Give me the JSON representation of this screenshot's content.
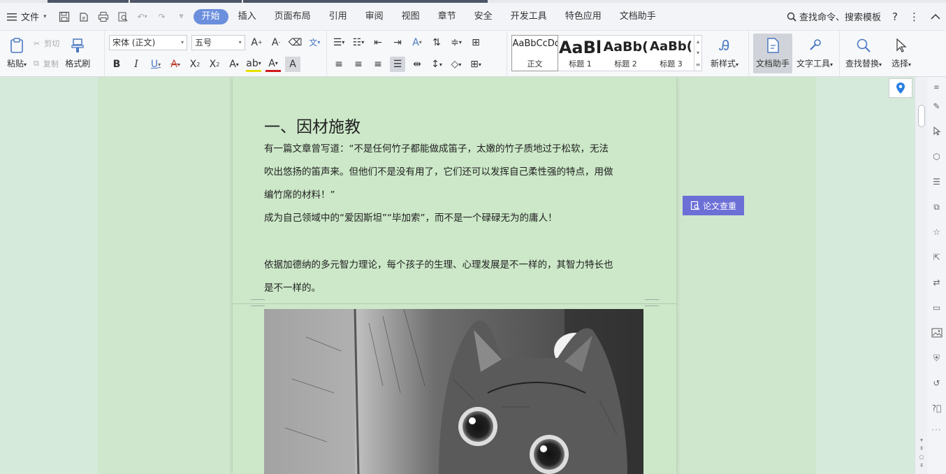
{
  "menubar": {
    "file_label": "文件",
    "tabs": [
      "开始",
      "插入",
      "页面布局",
      "引用",
      "审阅",
      "视图",
      "章节",
      "安全",
      "开发工具",
      "特色应用",
      "文档助手"
    ],
    "active_tab": "开始",
    "search_label": "查找命令、搜索模板",
    "help_label": "?"
  },
  "ribbon": {
    "paste_label": "粘贴",
    "cut_label": "剪切",
    "copy_label": "复制",
    "format_painter_label": "格式刷",
    "font_name": "宋体 (正文)",
    "font_size": "五号",
    "styles": [
      {
        "sample": "AaBbCcDd",
        "name": "正文"
      },
      {
        "sample": "AaBl",
        "name": "标题 1"
      },
      {
        "sample": "AaBb(",
        "name": "标题 2"
      },
      {
        "sample": "AaBb(",
        "name": "标题 3"
      }
    ],
    "new_style_label": "新样式",
    "doc_assistant_label": "文档助手",
    "text_tools_label": "文字工具",
    "find_replace_label": "查找替换",
    "select_label": "选择"
  },
  "document": {
    "heading": "一、因材施教",
    "paragraphs": [
      "有一篇文章曾写道：“不是任何竹子都能做成笛子，太嫩的竹子质地过于松软，无法",
      "吹出悠扬的笛声来。但他们不是没有用了，它们还可以发挥自己柔性强的特点，用做",
      "编竹席的材料！”",
      "成为自己领域中的“爱因斯坦”“毕加索”，而不是一个碌碌无为的庸人！",
      "依据加德纳的多元智力理论，每个孩子的生理、心理发展是不一样的，其智力特长也",
      "是不一样的。"
    ]
  },
  "floating": {
    "plagiarism_check_label": "论文查重"
  },
  "colors": {
    "accent": "#6b8fdd",
    "page_bg": "#cce8c8",
    "float_btn": "#6b6fd6"
  }
}
